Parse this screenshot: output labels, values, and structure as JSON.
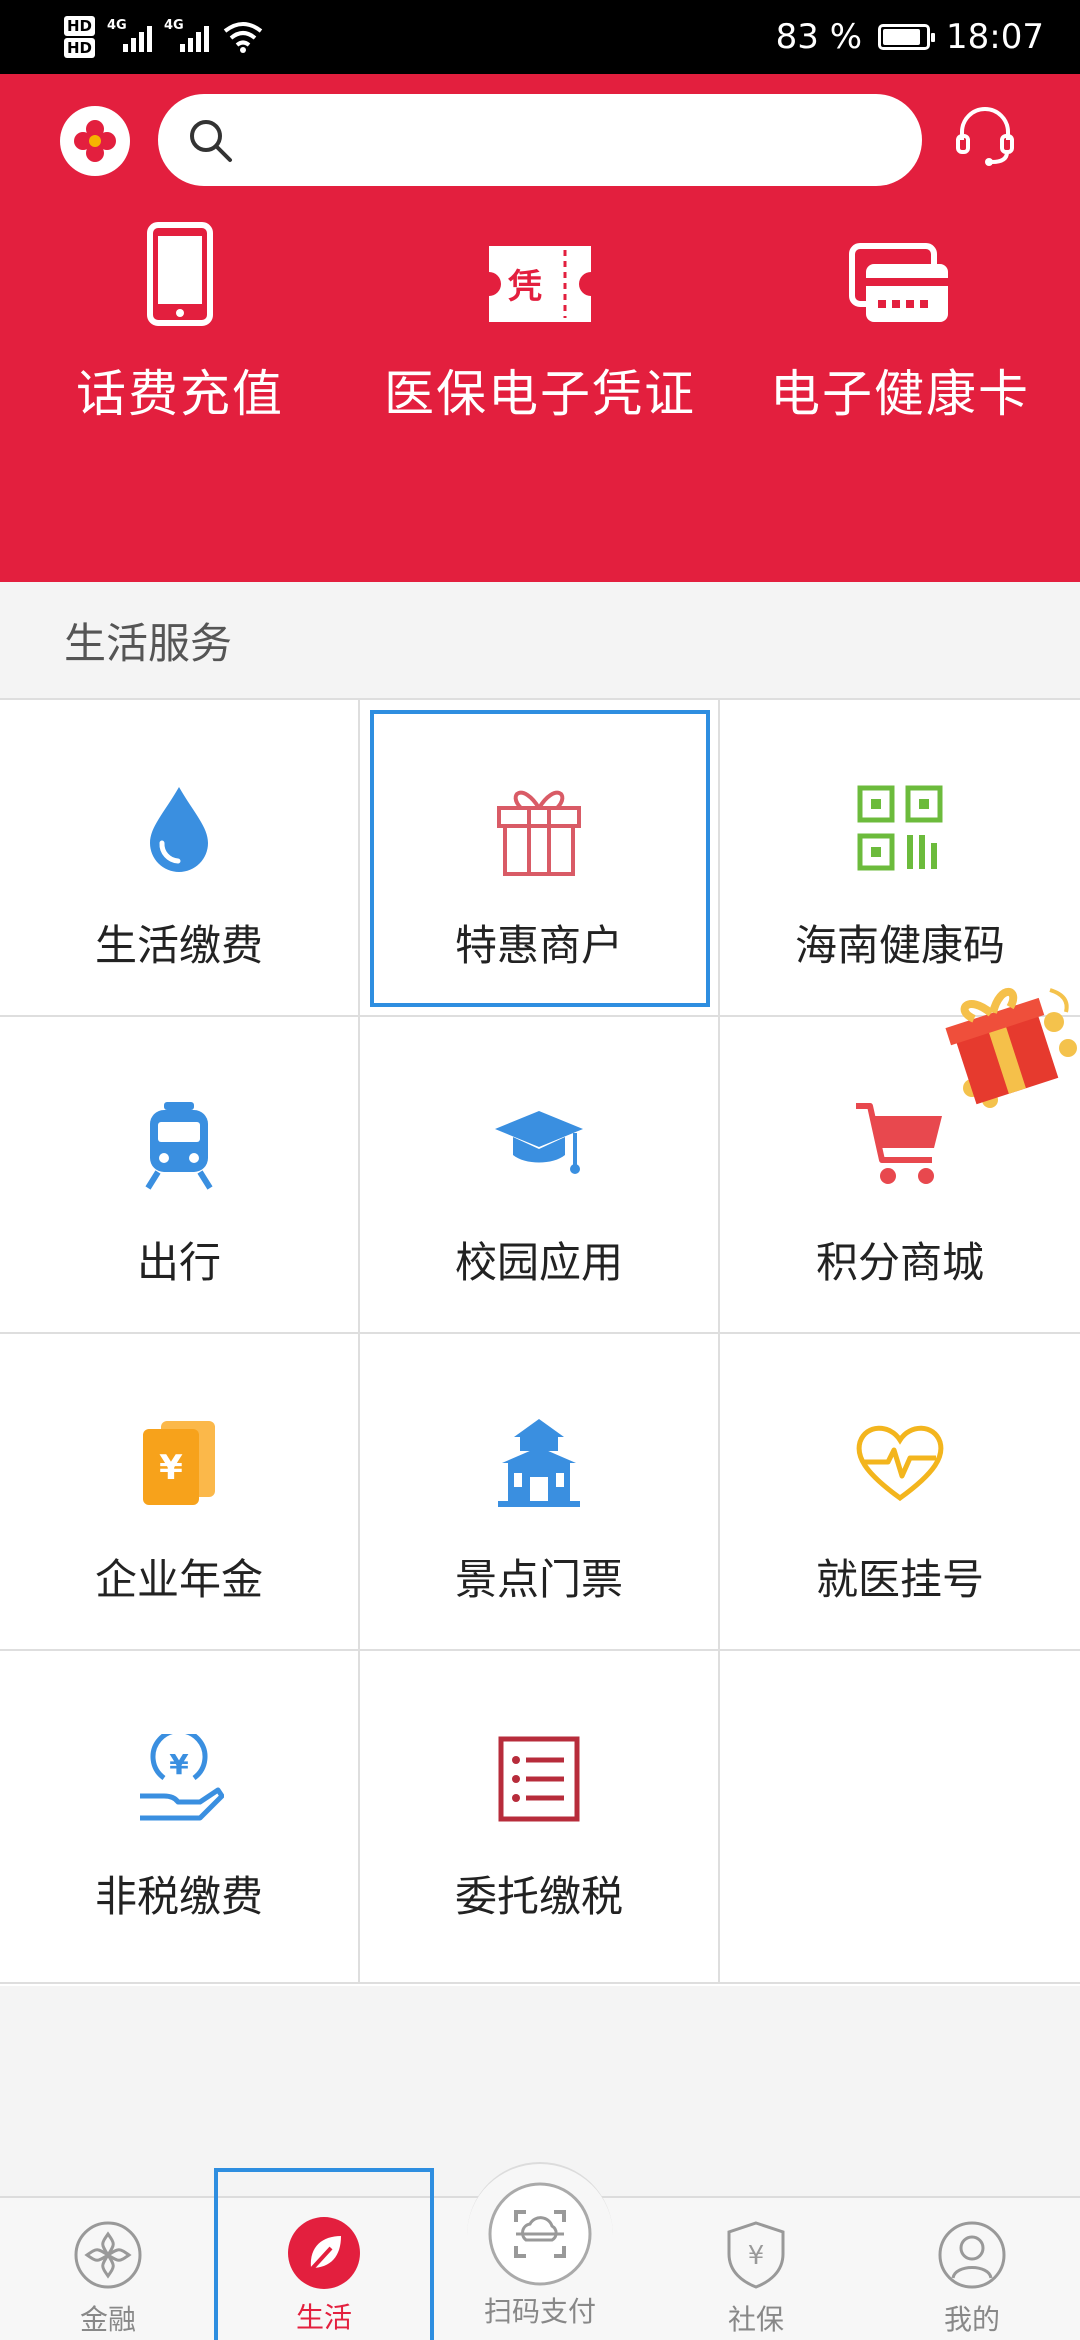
{
  "status_bar": {
    "hd1": "HD",
    "hd2": "HD",
    "network": "4G",
    "network2": "4G",
    "battery": "83 %",
    "time": "18:07"
  },
  "header": {
    "search_placeholder": "",
    "quick_actions": [
      {
        "label": "话费充值",
        "icon": "phone-icon"
      },
      {
        "label": "医保电子凭证",
        "icon": "voucher-icon"
      },
      {
        "label": "电子健康卡",
        "icon": "health-card-icon"
      }
    ]
  },
  "section": {
    "title": "生活服务"
  },
  "services": [
    {
      "label": "生活缴费",
      "icon": "water-drop-icon"
    },
    {
      "label": "特惠商户",
      "icon": "gift-icon"
    },
    {
      "label": "海南健康码",
      "icon": "qr-code-icon"
    },
    {
      "label": "出行",
      "icon": "train-icon"
    },
    {
      "label": "校园应用",
      "icon": "graduation-cap-icon"
    },
    {
      "label": "积分商城",
      "icon": "cart-icon"
    },
    {
      "label": "企业年金",
      "icon": "yuan-card-icon"
    },
    {
      "label": "景点门票",
      "icon": "temple-icon"
    },
    {
      "label": "就医挂号",
      "icon": "heartbeat-icon"
    },
    {
      "label": "非税缴费",
      "icon": "coin-hand-icon"
    },
    {
      "label": "委托缴税",
      "icon": "list-icon"
    }
  ],
  "bottom_nav": [
    {
      "label": "金融",
      "icon": "finance-icon"
    },
    {
      "label": "生活",
      "icon": "leaf-icon"
    },
    {
      "label": "扫码支付",
      "icon": "scan-icon"
    },
    {
      "label": "社保",
      "icon": "shield-yuan-icon"
    },
    {
      "label": "我的",
      "icon": "person-icon"
    }
  ],
  "colors": {
    "brand_red": "#e31f3e",
    "selection_blue": "#2e8ee0"
  }
}
